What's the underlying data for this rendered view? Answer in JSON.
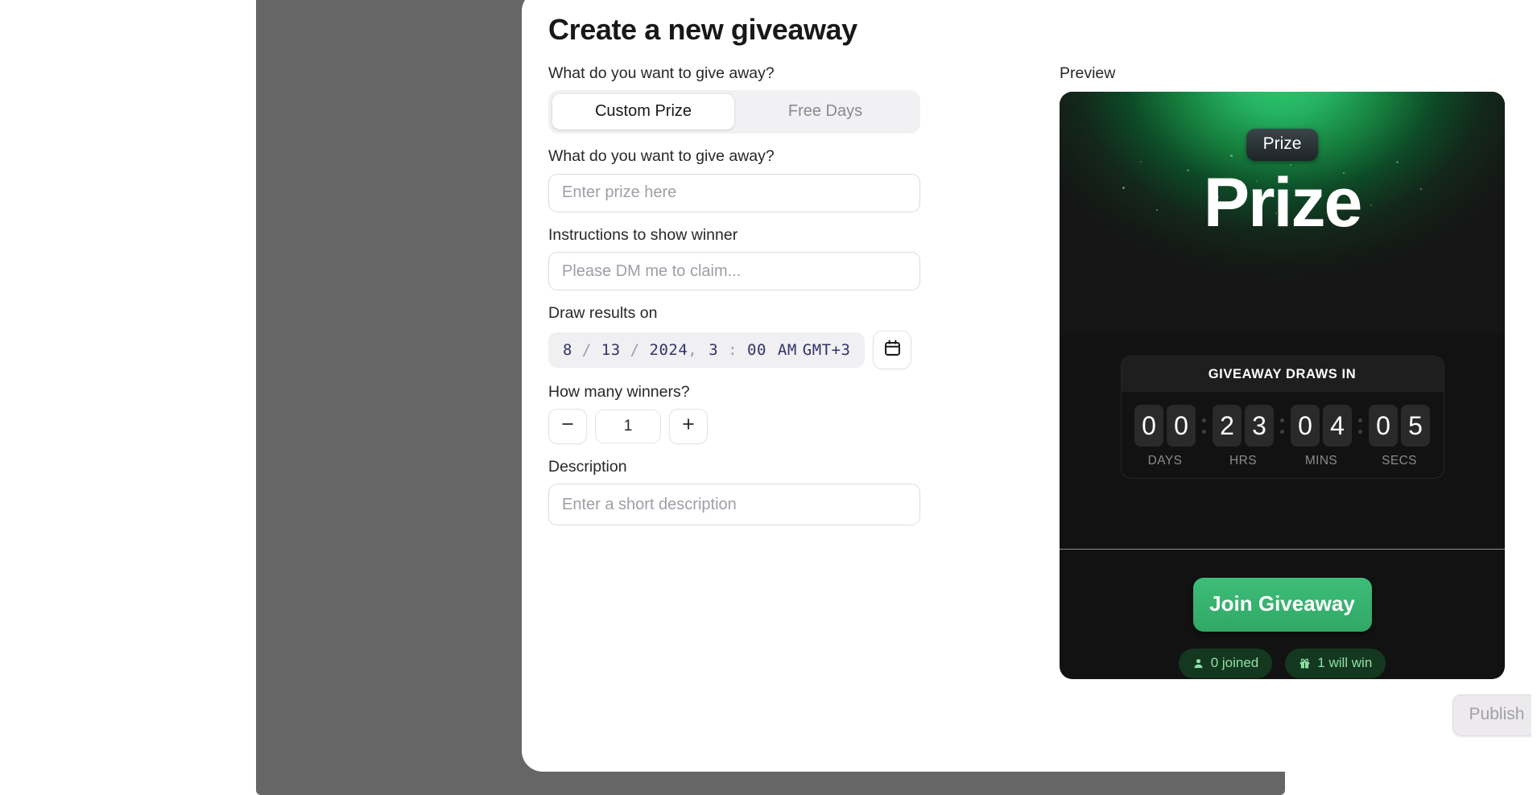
{
  "page": {
    "title": "Create a new giveaway"
  },
  "form": {
    "giveaway_type_label": "What do you want to give away?",
    "tabs": [
      {
        "label": "Custom Prize",
        "active": true
      },
      {
        "label": "Free Days",
        "active": false
      }
    ],
    "prize_label": "What do you want to give away?",
    "prize_value": "",
    "prize_placeholder": "Enter prize here",
    "instructions_label": "Instructions to show winner",
    "instructions_value": "",
    "instructions_placeholder": "Please DM me to claim...",
    "draw_label": "Draw results on",
    "date": {
      "month": "8",
      "day": "13",
      "year": "2024",
      "hour": "3",
      "minute": "00",
      "meridiem": "AM",
      "timezone": "GMT+3",
      "calendar_icon": "calendar-icon"
    },
    "winners_label": "How many winners?",
    "winners_value": "1",
    "decrement_icon": "minus-icon",
    "increment_icon": "plus-icon",
    "description_label": "Description",
    "description_value": "",
    "description_placeholder": "Enter a short description"
  },
  "preview": {
    "label": "Preview",
    "badge": "Prize",
    "title": "Prize",
    "countdown": {
      "heading": "GIVEAWAY DRAWS IN",
      "days": "00",
      "hours": "23",
      "minutes": "04",
      "seconds": "05",
      "unit_days": "DAYS",
      "unit_hours": "HRS",
      "unit_minutes": "MINS",
      "unit_seconds": "SECS"
    },
    "join_label": "Join Giveaway",
    "stats": [
      {
        "icon": "person-icon",
        "label": "0 joined"
      },
      {
        "icon": "gift-icon",
        "label": "1 will win"
      }
    ]
  },
  "footer": {
    "publish_label": "Publish"
  },
  "colors": {
    "accent_green": "#31a866",
    "glow_green": "#2ec96f",
    "card_dark": "#121212",
    "badge_green_bg": "#14381f",
    "badge_green_text": "#8ee0a8",
    "date_text": "#33336b",
    "frame_gray": "#666666"
  }
}
